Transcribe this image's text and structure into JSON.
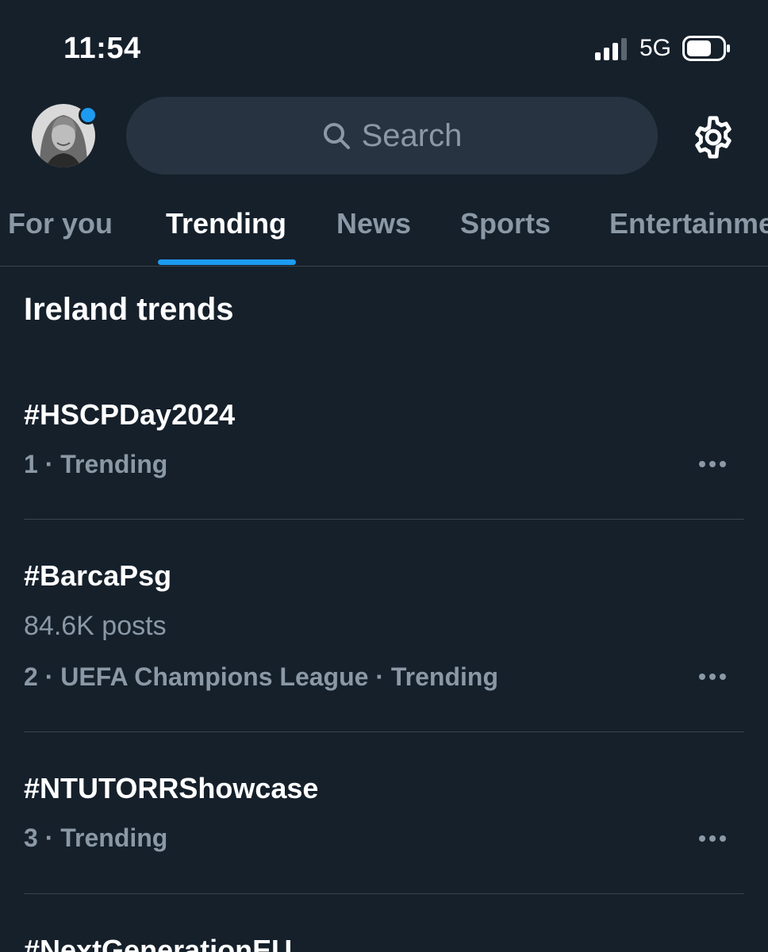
{
  "status": {
    "time": "11:54",
    "network": "5G"
  },
  "search": {
    "placeholder": "Search"
  },
  "tabs": [
    {
      "label": "For you"
    },
    {
      "label": "Trending"
    },
    {
      "label": "News"
    },
    {
      "label": "Sports"
    },
    {
      "label": "Entertainme"
    }
  ],
  "active_tab": "Trending",
  "section": {
    "title": "Ireland trends"
  },
  "trends": [
    {
      "hashtag": "#HSCPDay2024",
      "meta": "1 · Trending"
    },
    {
      "hashtag": "#BarcaPsg",
      "posts": "84.6K posts",
      "meta": "2 · UEFA Champions League · Trending"
    },
    {
      "hashtag": "#NTUTORRShowcase",
      "meta": "3 · Trending"
    },
    {
      "hashtag": "#NextGenerationEU"
    }
  ],
  "colors": {
    "background": "#15202b",
    "accent": "#1d9bf0",
    "secondary_text": "#8b98a5",
    "search_bg": "#273340"
  },
  "icons": [
    "signal-icon",
    "battery-icon",
    "search-icon",
    "gear-icon",
    "more-icon"
  ]
}
